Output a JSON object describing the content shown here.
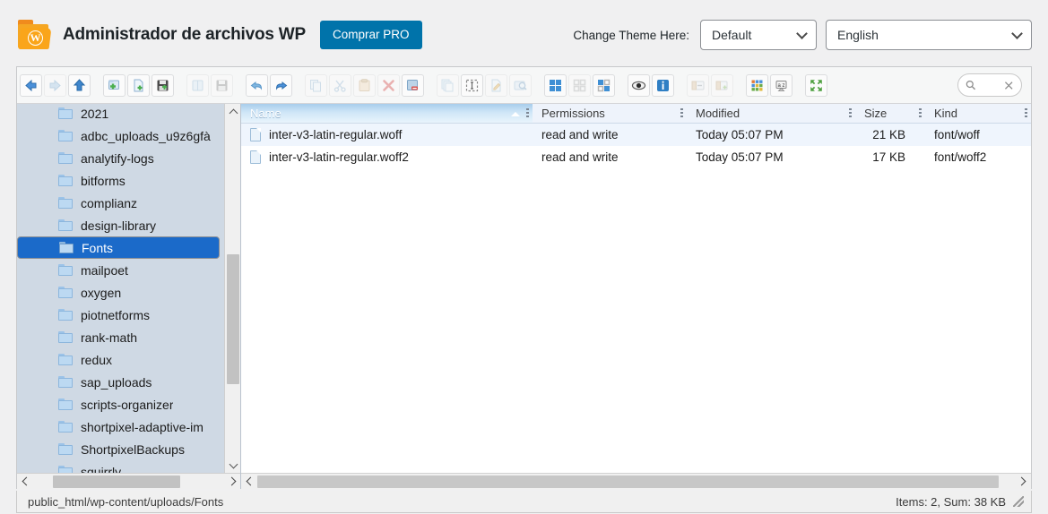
{
  "header": {
    "brand_icon": "wp-folder-logo",
    "title": "Administrador de archivos WP",
    "pro_button": "Comprar PRO",
    "theme_label": "Change Theme Here:",
    "theme_value": "Default",
    "language_value": "English",
    "accent_color": "#0073aa",
    "logo_color": "#f5a623"
  },
  "toolbar": {
    "groups": [
      {
        "buttons": [
          {
            "name": "back-icon",
            "title": "Back",
            "disabled": false
          },
          {
            "name": "forward-icon",
            "title": "Forward",
            "disabled": true
          },
          {
            "name": "up-directory-icon",
            "title": "Up",
            "disabled": false
          }
        ]
      },
      {
        "buttons": [
          {
            "name": "new-folder-icon",
            "title": "New Folder",
            "disabled": false
          },
          {
            "name": "new-file-icon",
            "title": "New File",
            "disabled": false
          },
          {
            "name": "save-icon",
            "title": "Save",
            "disabled": false
          }
        ]
      },
      {
        "buttons": [
          {
            "name": "open-folder-icon",
            "title": "Open",
            "disabled": true
          },
          {
            "name": "save-disk-icon",
            "title": "Save As",
            "disabled": true
          }
        ]
      },
      {
        "buttons": [
          {
            "name": "undo-icon",
            "title": "Undo",
            "disabled": false
          },
          {
            "name": "redo-icon",
            "title": "Redo",
            "disabled": false
          }
        ]
      },
      {
        "buttons": [
          {
            "name": "copy-icon",
            "title": "Copy",
            "disabled": true
          },
          {
            "name": "cut-icon",
            "title": "Cut",
            "disabled": true
          },
          {
            "name": "paste-icon",
            "title": "Paste",
            "disabled": true
          },
          {
            "name": "delete-icon",
            "title": "Delete",
            "disabled": true
          },
          {
            "name": "remove-icon",
            "title": "Remove",
            "disabled": false
          }
        ]
      },
      {
        "buttons": [
          {
            "name": "duplicate-icon",
            "title": "Duplicate",
            "disabled": true
          },
          {
            "name": "select-all-icon",
            "title": "Select All",
            "disabled": false
          },
          {
            "name": "rename-icon",
            "title": "Rename",
            "disabled": true
          },
          {
            "name": "search-in-folder-icon",
            "title": "Search",
            "disabled": true
          }
        ]
      },
      {
        "buttons": [
          {
            "name": "grid-view-icon",
            "title": "Grid View",
            "disabled": false
          },
          {
            "name": "list-view-icon",
            "title": "List View",
            "disabled": true
          },
          {
            "name": "detail-view-icon",
            "title": "Detail View",
            "disabled": false
          }
        ]
      },
      {
        "buttons": [
          {
            "name": "preview-icon",
            "title": "Preview",
            "disabled": false
          },
          {
            "name": "info-icon",
            "title": "Info",
            "disabled": false
          }
        ]
      },
      {
        "buttons": [
          {
            "name": "extract-archive-icon",
            "title": "Extract",
            "disabled": true
          },
          {
            "name": "create-archive-icon",
            "title": "Archive",
            "disabled": true
          }
        ]
      },
      {
        "buttons": [
          {
            "name": "thumbnails-icon",
            "title": "Thumbnails",
            "disabled": false
          },
          {
            "name": "sort-alpha-icon",
            "title": "Sort",
            "disabled": false
          }
        ]
      },
      {
        "buttons": [
          {
            "name": "fullscreen-icon",
            "title": "Fullscreen",
            "disabled": false
          }
        ]
      }
    ],
    "search_placeholder": "",
    "search_value": ""
  },
  "tree": {
    "items": [
      {
        "label": "2021",
        "expandable": true,
        "selected": false
      },
      {
        "label": "adbc_uploads_u9z6gfà",
        "expandable": false,
        "selected": false
      },
      {
        "label": "analytify-logs",
        "expandable": false,
        "selected": false
      },
      {
        "label": "bitforms",
        "expandable": true,
        "selected": false
      },
      {
        "label": "complianz",
        "expandable": true,
        "selected": false
      },
      {
        "label": "design-library",
        "expandable": true,
        "selected": false
      },
      {
        "label": "Fonts",
        "expandable": false,
        "selected": true
      },
      {
        "label": "mailpoet",
        "expandable": true,
        "selected": false
      },
      {
        "label": "oxygen",
        "expandable": true,
        "selected": false
      },
      {
        "label": "piotnetforms",
        "expandable": true,
        "selected": false
      },
      {
        "label": "rank-math",
        "expandable": false,
        "selected": false
      },
      {
        "label": "redux",
        "expandable": false,
        "selected": false
      },
      {
        "label": "sap_uploads",
        "expandable": false,
        "selected": false
      },
      {
        "label": "scripts-organizer",
        "expandable": false,
        "selected": false
      },
      {
        "label": "shortpixel-adaptive-im",
        "expandable": true,
        "selected": false
      },
      {
        "label": "ShortpixelBackups",
        "expandable": true,
        "selected": false
      },
      {
        "label": "squirrly",
        "expandable": false,
        "selected": false
      }
    ],
    "selected_color": "#1b6ac9"
  },
  "file_list": {
    "columns": [
      {
        "key": "name",
        "label": "Name",
        "sorted": true,
        "sort_direction": "asc"
      },
      {
        "key": "permissions",
        "label": "Permissions"
      },
      {
        "key": "modified",
        "label": "Modified"
      },
      {
        "key": "size",
        "label": "Size"
      },
      {
        "key": "kind",
        "label": "Kind"
      }
    ],
    "rows": [
      {
        "name": "inter-v3-latin-regular.woff",
        "permissions": "read and write",
        "modified": "Today 05:07 PM",
        "size": "21 KB",
        "kind": "font/woff",
        "highlighted": true
      },
      {
        "name": "inter-v3-latin-regular.woff2",
        "permissions": "read and write",
        "modified": "Today 05:07 PM",
        "size": "17 KB",
        "kind": "font/woff2",
        "highlighted": false
      }
    ]
  },
  "status": {
    "path": "public_html/wp-content/uploads/Fonts",
    "summary": "Items: 2, Sum: 38 KB"
  }
}
